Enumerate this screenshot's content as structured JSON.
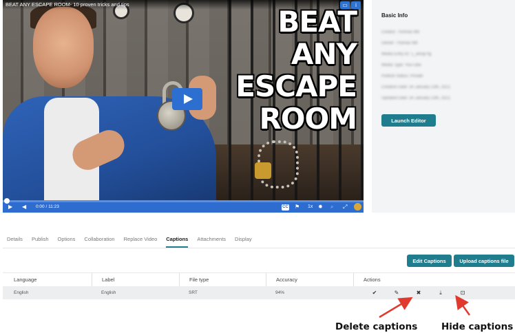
{
  "video": {
    "title": "BEAT ANY ESCAPE ROOM- 10 proven tricks and tips",
    "headline_line1": "BEAT ANY",
    "headline_line2": "ESCAPE",
    "headline_line3": "ROOM",
    "time": "0:00  / 11:23",
    "speed": "1x",
    "cc": "CC",
    "progress_fraction": 0.0
  },
  "info_panel": {
    "title": "Basic Info",
    "blurred_rows": [
      "Creator: Thomas Mb",
      "Owner: Thomas Mb",
      "Media Entry ID: 1_a4sqi7tg",
      "Media Type: YouTube",
      "Publish Status: Private",
      "Creation Date: on January 13th, 2021",
      "Updated Date: on January 13th, 2021"
    ],
    "launch_editor_label": "Launch Editor"
  },
  "tabs": [
    {
      "label": "Details",
      "active": false
    },
    {
      "label": "Publish",
      "active": false
    },
    {
      "label": "Options",
      "active": false
    },
    {
      "label": "Collaboration",
      "active": false
    },
    {
      "label": "Replace Video",
      "active": false
    },
    {
      "label": "Captions",
      "active": true
    },
    {
      "label": "Attachments",
      "active": false
    },
    {
      "label": "Display",
      "active": false
    }
  ],
  "buttons": {
    "edit_captions": "Edit Captions",
    "upload_captions": "Upload captions file"
  },
  "table": {
    "headers": {
      "language": "Language",
      "label": "Label",
      "file_type": "File type",
      "accuracy": "Accuracy",
      "actions": "Actions"
    },
    "rows": [
      {
        "language": "English",
        "label": "English",
        "file_type": "SRT",
        "accuracy": "94%",
        "actions": [
          "check-icon",
          "pencil-icon",
          "delete-x-icon",
          "download-icon",
          "hide-caption-icon"
        ]
      }
    ]
  },
  "annotations": {
    "delete": "Delete captions",
    "hide": "Hide captions",
    "arrow_color": "#e03a2f"
  },
  "colors": {
    "accent": "#1f7d8e",
    "player_blue": "#2f6ccf"
  }
}
